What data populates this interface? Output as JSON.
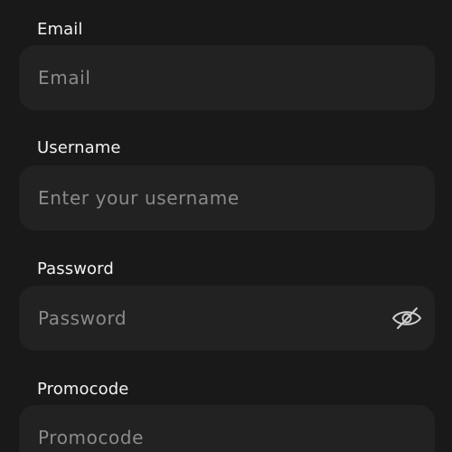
{
  "form": {
    "email": {
      "label": "Email",
      "placeholder": "Email",
      "value": ""
    },
    "username": {
      "label": "Username",
      "placeholder": "Enter your username",
      "value": ""
    },
    "password": {
      "label": "Password",
      "placeholder": "Password",
      "value": "",
      "toggle_icon": "eye-slash-icon"
    },
    "promocode": {
      "label": "Promocode",
      "placeholder": "Promocode",
      "value": ""
    }
  },
  "colors": {
    "background": "#191919",
    "input_background": "#222222",
    "label_text": "#f2f2f2",
    "placeholder_text": "#8a8a8a"
  }
}
